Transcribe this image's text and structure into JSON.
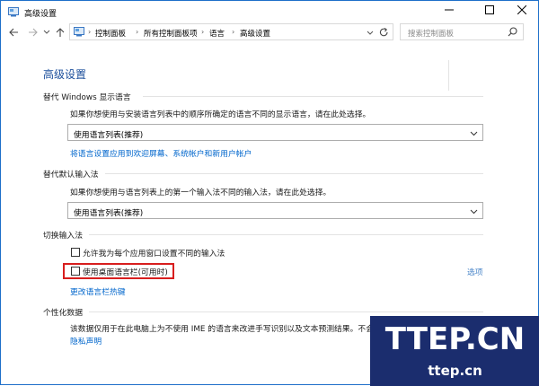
{
  "window": {
    "title": "高级设置"
  },
  "titlebar": {
    "min_icon": "minimize-icon",
    "max_icon": "maximize-icon",
    "close_icon": "close-icon"
  },
  "nav": {
    "breadcrumb": [
      "控制面板",
      "所有控制面板项",
      "语言",
      "高级设置"
    ],
    "search_placeholder": "搜索控制面板"
  },
  "page": {
    "title": "高级设置",
    "sections": {
      "display_language": {
        "title": "替代 Windows 显示语言",
        "desc": "如果你想使用与安装语言列表中的顺序所确定的语言不同的显示语言，请在此处选择。",
        "select_value": "使用语言列表(推荐)",
        "link": "将语言设置应用到欢迎屏幕、系统帐户和新用户帐户"
      },
      "input_method": {
        "title": "替代默认输入法",
        "desc": "如果你想使用与语言列表上的第一个输入法不同的输入法，请在此处选择。",
        "select_value": "使用语言列表(推荐)"
      },
      "switch_input": {
        "title": "切换输入法",
        "checkbox1": "允许我为每个应用窗口设置不同的输入法",
        "checkbox2": "使用桌面语言栏(可用时)",
        "options_link": "选项",
        "hotkey_link": "更改语言栏热键"
      },
      "personalization": {
        "title": "个性化数据",
        "desc": "该数据仅用于在此电脑上为不使用 IME 的语言来改进手写识别以及文本预测结果。不会",
        "privacy_link": "隐私声明"
      }
    }
  },
  "watermark": {
    "main": "TTEP.CN",
    "sub": "ttep.cn"
  },
  "colors": {
    "accent": "#0066cc",
    "title_blue": "#1b4e9b",
    "highlight_red": "#d81e1e",
    "watermark_bg": "#1b2d6e"
  }
}
